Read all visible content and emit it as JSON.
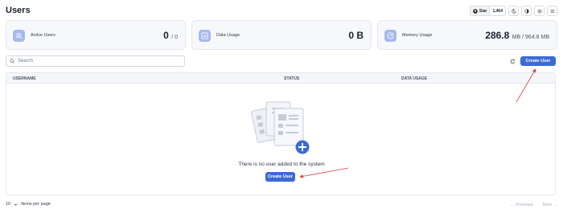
{
  "header": {
    "title": "Users",
    "github": {
      "star_label": "Star",
      "count": "1,464"
    }
  },
  "stats": [
    {
      "label": "Active Users",
      "value": "0",
      "sub": "/ 0",
      "icon": "users-icon"
    },
    {
      "label": "Data Usage",
      "value": "0 B",
      "sub": "",
      "icon": "chart-icon"
    },
    {
      "label": "Memory Usage",
      "value": "286.8",
      "sub": "MB / 964.8 MB",
      "icon": "gauge-icon"
    }
  ],
  "toolbar": {
    "search_placeholder": "Search",
    "create_label": "Create User"
  },
  "table": {
    "columns": [
      "USERNAME",
      "STATUS",
      "DATA USAGE"
    ],
    "empty_text": "There is no user added to the system",
    "empty_create_label": "Create User"
  },
  "footer": {
    "per_page_value": "10",
    "per_page_label": "Items per page",
    "prev_label": "Previous",
    "next_label": "Next"
  },
  "colors": {
    "accent": "#3b6ad7",
    "annotation": "#e53e3e"
  }
}
